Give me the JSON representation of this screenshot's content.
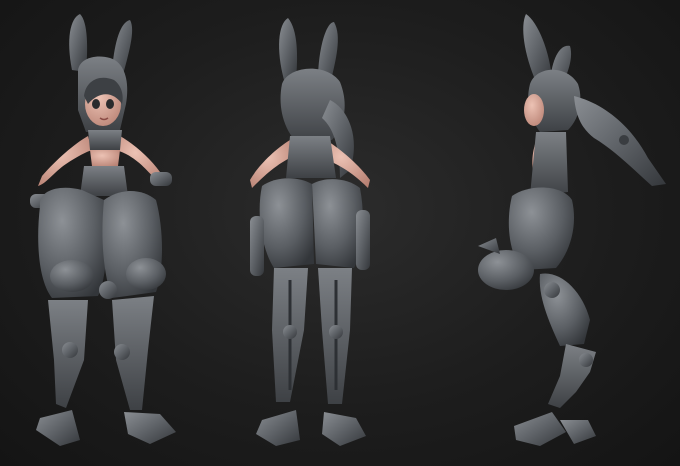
{
  "scene": {
    "background_color": "#1e1e1e",
    "armor_color": "#5f6368",
    "armor_shadow_color": "#3a3d41",
    "armor_highlight_color": "#8a8e93",
    "skin_color": "#d9a79a",
    "views": [
      {
        "name": "front-view",
        "facing": "front"
      },
      {
        "name": "back-view",
        "facing": "back"
      },
      {
        "name": "side-view",
        "facing": "side"
      }
    ]
  }
}
